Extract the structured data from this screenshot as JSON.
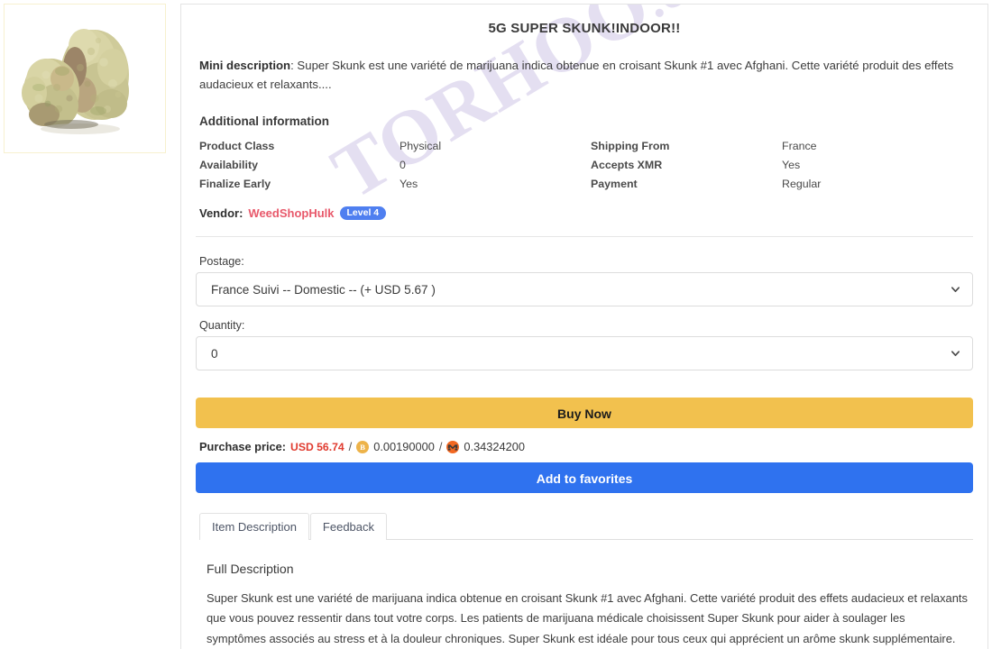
{
  "product": {
    "title": "5G SUPER SKUNK!INDOOR!!",
    "mini_description_label": "Mini description",
    "mini_description_text": ": Super Skunk est une variété de marijuana indica obtenue en croisant Skunk #1 avec Afghani. Cette variété produit des effets audacieux et relaxants...."
  },
  "thumbnail": {
    "alt": "cannabis-bud-photo"
  },
  "watermark": {
    "text": "TORHOO",
    "suffix": ".com"
  },
  "additional_information": {
    "heading": "Additional information",
    "rows": [
      {
        "label": "Product Class",
        "value": "Physical",
        "label2": "Shipping From",
        "value2": "France"
      },
      {
        "label": "Availability",
        "value": "0",
        "label2": "Accepts XMR",
        "value2": "Yes"
      },
      {
        "label": "Finalize Early",
        "value": "Yes",
        "label2": "Payment",
        "value2": "Regular"
      }
    ]
  },
  "vendor": {
    "label": "Vendor:",
    "name": "WeedShopHulk",
    "level_badge": "Level 4",
    "badge_color": "#4f7ff0",
    "name_color": "#e8596b"
  },
  "form": {
    "postage_label": "Postage:",
    "postage_value": "France Suivi -- Domestic -- (+ USD 5.67 )",
    "quantity_label": "Quantity:",
    "quantity_value": "0"
  },
  "actions": {
    "buy_now": "Buy Now",
    "buy_now_color": "#f2c14e",
    "add_to_favorites": "Add to favorites",
    "add_to_favorites_color": "#2f72ef"
  },
  "price": {
    "label": "Purchase price:",
    "usd": "USD 56.74",
    "usd_color": "#e03b2f",
    "separator": "/",
    "btc_icon": "bitcoin-icon",
    "btc": "0.00190000",
    "xmr_icon": "monero-icon",
    "xmr": "0.34324200"
  },
  "tabs": [
    {
      "label": "Item Description",
      "active": true
    },
    {
      "label": "Feedback",
      "active": false
    }
  ],
  "full_description": {
    "heading": "Full Description",
    "body": "Super Skunk est une variété de marijuana indica obtenue en croisant Skunk #1 avec Afghani. Cette variété produit des effets audacieux et relaxants que vous pouvez ressentir dans tout votre corps. Les patients de marijuana médicale choisissent Super Skunk pour aider à soulager les symptômes associés au stress et à la douleur chroniques. Super Skunk est idéale pour tous ceux qui apprécient un arôme skunk supplémentaire."
  }
}
